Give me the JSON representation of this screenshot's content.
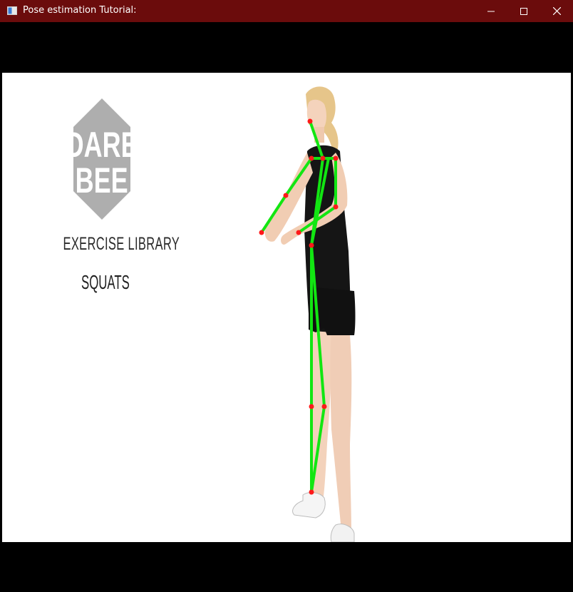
{
  "window": {
    "title": "Pose estimation Tutorial:",
    "titlebar_color": "#6b0c0c"
  },
  "controls": {
    "minimize_icon": "minimize-icon",
    "maximize_icon": "maximize-icon",
    "close_icon": "close-icon"
  },
  "video": {
    "logo_line1": "DARE",
    "logo_line2": "BEE",
    "library_label": "EXERCISE LIBRARY",
    "exercise_name": "SQUATS",
    "skeleton_line_color": "#12e612",
    "keypoint_color": "#ff1a1a"
  }
}
